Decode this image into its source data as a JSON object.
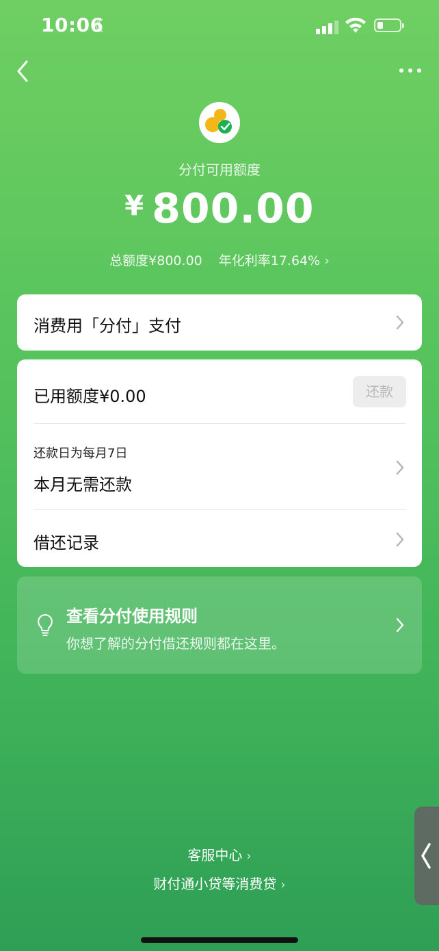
{
  "status": {
    "time": "10:06"
  },
  "header": {
    "available_label": "分付可用额度",
    "currency_symbol": "¥",
    "available_amount": "800.00",
    "total_limit": "总额度¥800.00",
    "annual_rate": "年化利率17.64%"
  },
  "pay_card": {
    "label": "消费用「分付」支付"
  },
  "main_card": {
    "used_label": "已用额度¥0.00",
    "repay_button": "还款",
    "due_subtitle": "还款日为每月7日",
    "due_status": "本月无需还款",
    "records_label": "借还记录"
  },
  "rules_card": {
    "title": "查看分付使用规则",
    "subtitle": "你想了解的分付借还规则都在这里。"
  },
  "footer": {
    "service_center": "客服中心",
    "lender_info": "财付通小贷等消费贷"
  },
  "side_tab": {
    "icon": "chevron-left-icon"
  },
  "colors": {
    "background_top": "#6fcf62",
    "background_bottom": "#2e9f55",
    "card": "#ffffff",
    "logo_yellow": "#f3b719",
    "logo_green": "#19b154"
  }
}
